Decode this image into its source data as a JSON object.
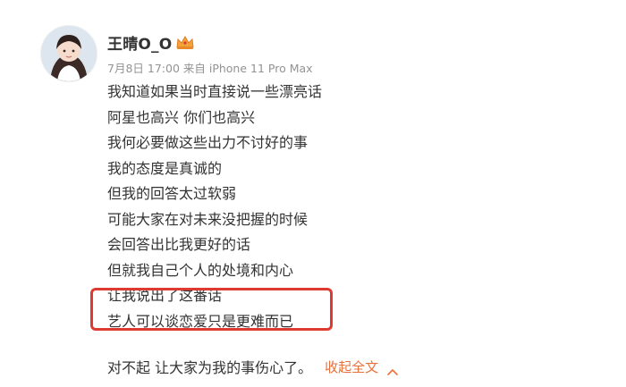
{
  "post": {
    "username": "王晴O_O",
    "meta": "7月8日 17:00 来自 iPhone 11 Pro Max",
    "lines": [
      "我知道如果当时直接说一些漂亮话",
      "阿星也高兴 你们也高兴",
      "我何必要做这些出力不讨好的事",
      "我的态度是真诚的",
      "但我的回答太过软弱",
      "可能大家在对未来没把握的时候",
      "会回答出比我更好的话",
      "但就我自己个人的处境和内心",
      "让我说出了这番话",
      "艺人可以谈恋爱只是更难而已"
    ],
    "last_line": "对不起 让大家为我的事伤心了。",
    "collapse_label": "收起全文"
  },
  "colors": {
    "highlight": "#dd3b32",
    "link": "#e8703a",
    "meta": "#939393",
    "text": "#333333"
  },
  "icons": {
    "badge": "crown-badge-icon",
    "collapse": "chevron-up-icon"
  }
}
